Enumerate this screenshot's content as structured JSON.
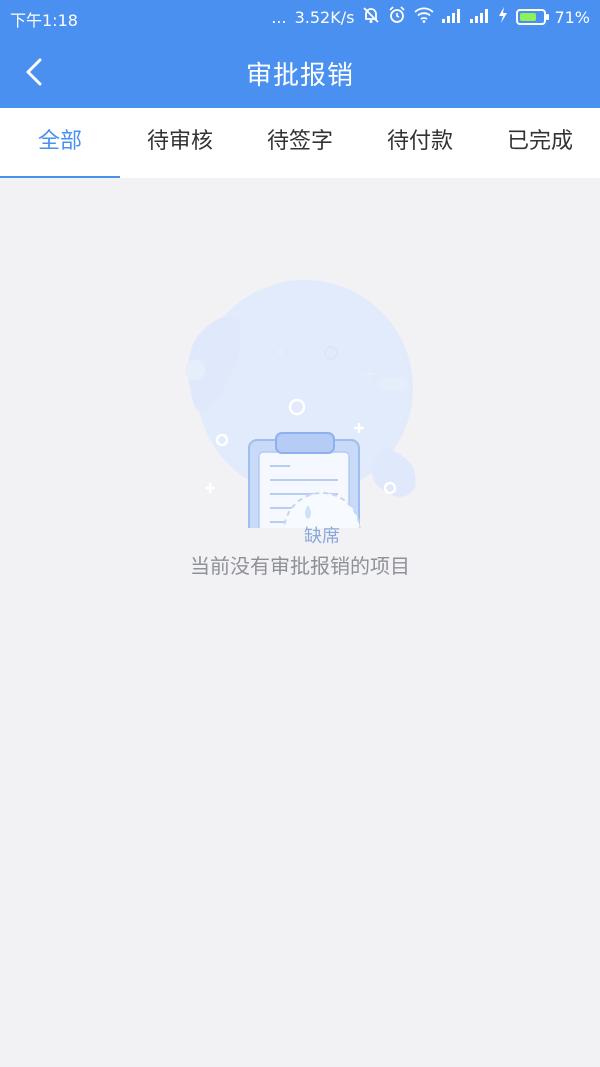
{
  "status_bar": {
    "time": "下午1:18",
    "dots": "...",
    "speed": "3.52K/s",
    "battery": "71%",
    "icons": [
      "mute-bell-icon",
      "alarm-icon",
      "wifi-icon",
      "signal-icon",
      "signal-icon",
      "charging-icon",
      "battery-icon"
    ]
  },
  "header": {
    "title": "审批报销",
    "back_icon": "chevron-left-icon"
  },
  "tabs": [
    {
      "label": "全部",
      "active": true
    },
    {
      "label": "待审核",
      "active": false
    },
    {
      "label": "待签字",
      "active": false
    },
    {
      "label": "待付款",
      "active": false
    },
    {
      "label": "已完成",
      "active": false
    }
  ],
  "empty_state": {
    "stamp_text": "缺席",
    "message": "当前没有审批报销的项目"
  },
  "colors": {
    "primary": "#4a90f0",
    "background": "#f2f2f4",
    "illustration_light": "#dde9fb"
  }
}
